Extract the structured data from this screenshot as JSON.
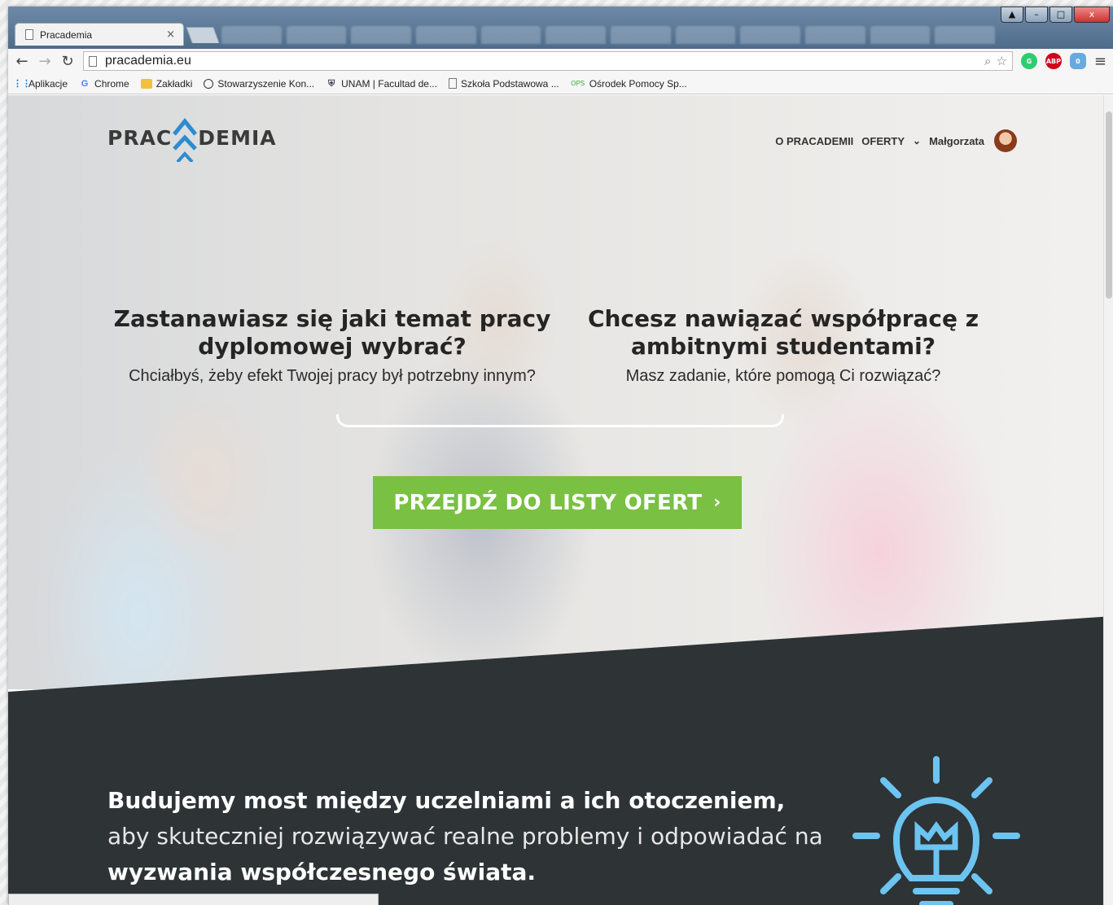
{
  "browser": {
    "tab_title": "Pracademia",
    "tab_close": "×",
    "url": "pracademia.eu",
    "window_controls": {
      "min": "–",
      "max": "□",
      "close": "x"
    },
    "extensions": {
      "abp": "ABP",
      "ghostery_badge": "0"
    },
    "bookmarks": [
      {
        "label": "Aplikacje",
        "icon": "apps-grid-icon"
      },
      {
        "label": "Chrome",
        "icon": "google-icon"
      },
      {
        "label": "Zakładki",
        "icon": "folder-icon"
      },
      {
        "label": "Stowarzyszenie Kon...",
        "icon": "circle-icon"
      },
      {
        "label": "UNAM | Facultad de...",
        "icon": "unam-icon"
      },
      {
        "label": "Szkoła Podstawowa ...",
        "icon": "page-icon"
      },
      {
        "label": "Ośrodek Pomocy Sp...",
        "icon": "ops-icon"
      }
    ]
  },
  "site": {
    "logo": {
      "pre": "PRAC",
      "post": "DEMIA"
    },
    "nav": {
      "about": "O PRACADEMII",
      "offers": "OFERTY",
      "user": "Małgorzata"
    },
    "hero": {
      "left_title": "Zastanawiasz się jaki temat pracy dyplomowej wybrać?",
      "left_sub": "Chciałbyś, żeby efekt Twojej pracy był potrzebny innym?",
      "right_title": "Chcesz nawiązać współpracę z ambitnymi studentami?",
      "right_sub": "Masz zadanie, które pomogą Ci rozwiązać?",
      "cta": "PRZEJDŹ DO LISTY OFERT",
      "cta_arrow": "›"
    },
    "mission": {
      "bold1": "Budujemy most między uczelniami a ich otoczeniem,",
      "light": " aby skuteczniej rozwiązywać realne problemy i odpowiadać na ",
      "bold2": "wyzwania współczesnego świata."
    }
  },
  "colors": {
    "accent_green": "#7ac043",
    "dark_band": "#2e3336",
    "bulb_blue": "#6cc4f0"
  }
}
